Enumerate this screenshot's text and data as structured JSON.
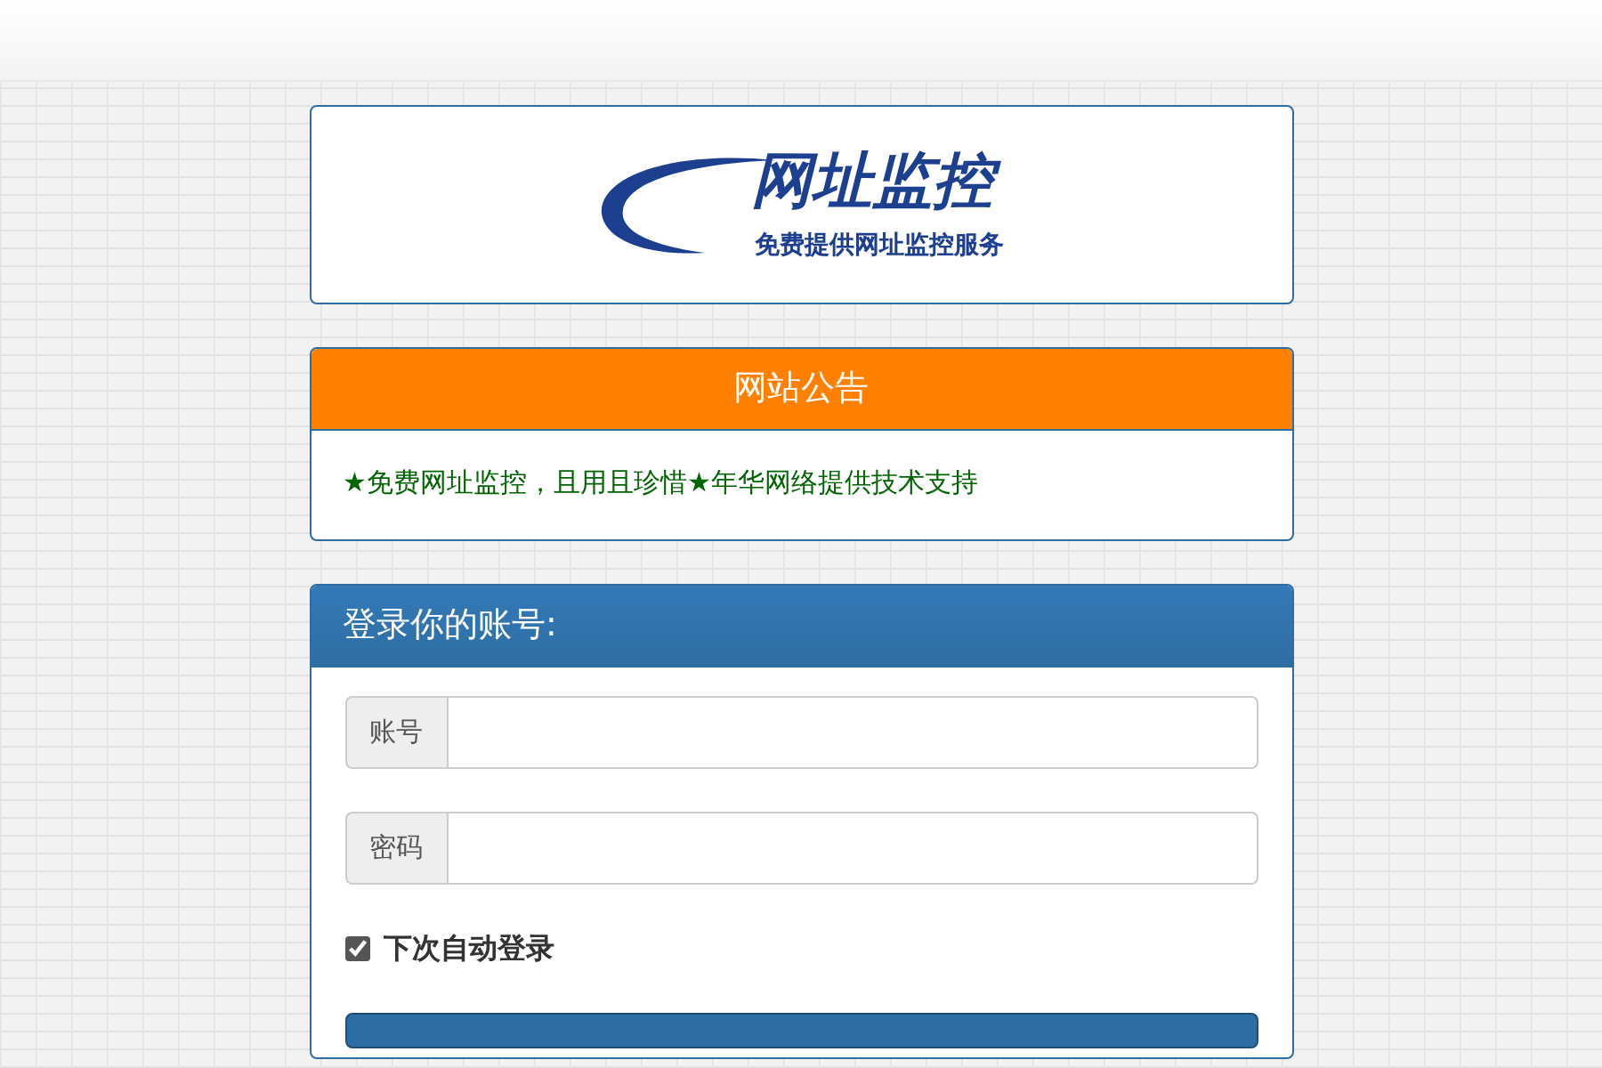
{
  "logo": {
    "title": "网址监控",
    "subtitle": "免费提供网址监控服务"
  },
  "notice": {
    "title": "网站公告",
    "text": "★免费网址监控，且用且珍惜★年华网络提供技术支持"
  },
  "login": {
    "title": "登录你的账号:",
    "fields": [
      {
        "label": "账号"
      },
      {
        "label": "密码"
      }
    ],
    "remember": {
      "label": "下次自动登录",
      "checked": true
    }
  }
}
